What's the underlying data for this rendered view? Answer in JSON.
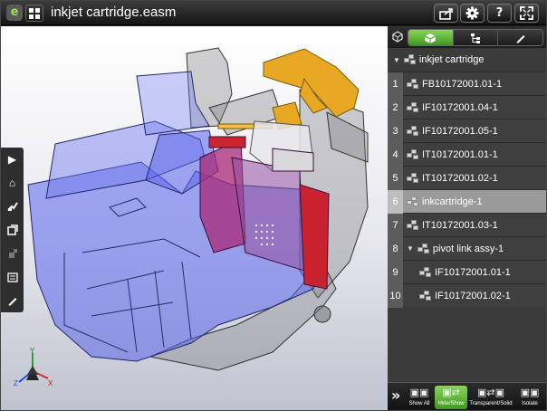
{
  "app": {
    "logo_text": "e",
    "title": "inkjet cartridge.easm"
  },
  "toolbar": {
    "share_icon": "share-icon",
    "settings_icon": "gear-icon",
    "help_label": "?",
    "fullscreen_icon": "fullscreen-icon"
  },
  "left_tools": [
    "play-icon",
    "home-icon",
    "walk-icon",
    "section-icon",
    "explode-icon",
    "measure-icon",
    "markup-icon"
  ],
  "panel": {
    "tabs": [
      "components-icon",
      "configurations-icon",
      "markup-icon"
    ],
    "active_tab": 0,
    "root_label": "inkjet cartridge",
    "items": [
      {
        "num": "1",
        "label": "FB10172001.01-1",
        "indent": 0
      },
      {
        "num": "2",
        "label": "IF10172001.04-1",
        "indent": 0
      },
      {
        "num": "3",
        "label": "IF10172001.05-1",
        "indent": 0
      },
      {
        "num": "4",
        "label": "IT10172001.01-1",
        "indent": 0
      },
      {
        "num": "5",
        "label": "IT10172001.02-1",
        "indent": 0
      },
      {
        "num": "6",
        "label": "inkcartridge-1",
        "indent": 0,
        "selected": true
      },
      {
        "num": "7",
        "label": "IT10172001.03-1",
        "indent": 0
      },
      {
        "num": "8",
        "label": "pivot link assy-1",
        "indent": 0,
        "expandable": true
      },
      {
        "num": "9",
        "label": "IF10172001.01-1",
        "indent": 1
      },
      {
        "num": "10",
        "label": "IF10172001.02-1",
        "indent": 1
      }
    ]
  },
  "bottom": {
    "expand_label": "»",
    "actions": [
      {
        "label": "Show All",
        "active": false
      },
      {
        "label": "Hide/Show",
        "active": true
      },
      {
        "label": "Transparent/Solid",
        "active": false
      },
      {
        "label": "Isolate",
        "active": false
      }
    ]
  },
  "triad": {
    "x_label": "X",
    "y_label": "Y",
    "z_label": "Z"
  }
}
